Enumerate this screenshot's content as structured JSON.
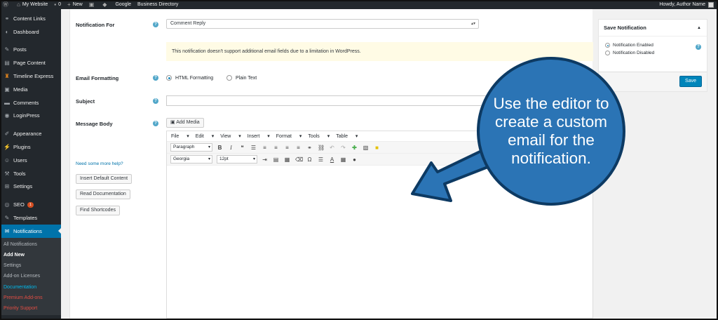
{
  "adminbar": {
    "site_name": "My Website",
    "comments_count": "0",
    "new_label": "New",
    "google_label": "Google",
    "directory_label": "Business Directory",
    "greeting": "Howdy, Author Name"
  },
  "sidebar": {
    "items": [
      {
        "label": "Content Links",
        "icon": "link-icon"
      },
      {
        "label": "Dashboard",
        "icon": "dashboard-icon"
      },
      {
        "label": "Posts",
        "icon": "pin-icon"
      },
      {
        "label": "Page Content",
        "icon": "page-icon"
      },
      {
        "label": "Timeline Express",
        "icon": "timeline-icon"
      },
      {
        "label": "Media",
        "icon": "media-icon"
      },
      {
        "label": "Comments",
        "icon": "comment-icon"
      },
      {
        "label": "LoginPress",
        "icon": "loginpress-icon"
      },
      {
        "label": "Appearance",
        "icon": "brush-icon"
      },
      {
        "label": "Plugins",
        "icon": "plugin-icon"
      },
      {
        "label": "Users",
        "icon": "user-icon"
      },
      {
        "label": "Tools",
        "icon": "wrench-icon"
      },
      {
        "label": "Settings",
        "icon": "settings-icon"
      },
      {
        "label": "SEO",
        "icon": "seo-icon",
        "badge": "1"
      },
      {
        "label": "Templates",
        "icon": "template-icon"
      },
      {
        "label": "Notifications",
        "icon": "mail-icon"
      }
    ],
    "submenu": [
      "All Notifications",
      "Add New",
      "Settings",
      "Add-on Licenses",
      "Documentation",
      "Premium Add-ons",
      "Priority Support"
    ]
  },
  "form": {
    "notification_for_label": "Notification For",
    "notification_for_value": "Comment Reply",
    "notice_text": "This notification doesn't support additional email fields due to a limitation in WordPress.",
    "email_formatting_label": "Email Formatting",
    "html_formatting": "HTML Formatting",
    "plain_text": "Plain Text",
    "subject_label": "Subject",
    "message_body_label": "Message Body",
    "add_media": "Add Media",
    "help_link": "Need some more help?",
    "insert_default": "Insert Default Content",
    "read_docs": "Read Documentation",
    "find_shortcodes": "Find Shortcodes"
  },
  "editor": {
    "menus": [
      "File",
      "Edit",
      "View",
      "Insert",
      "Format",
      "Tools",
      "Table"
    ],
    "format_select": "Paragraph",
    "font_select": "Georgia",
    "size_select": "12pt"
  },
  "panel": {
    "title": "Save Notification",
    "enabled": "Notification Enabled",
    "disabled": "Notification Disabled",
    "save": "Save"
  },
  "callout": {
    "text": "Use the editor to create a custom email for the notification."
  },
  "colors": {
    "sidebar_bg": "#23282d",
    "active_menu": "#0073aa",
    "callout": "#2b74b5",
    "notice_bg": "#fffbe5"
  }
}
